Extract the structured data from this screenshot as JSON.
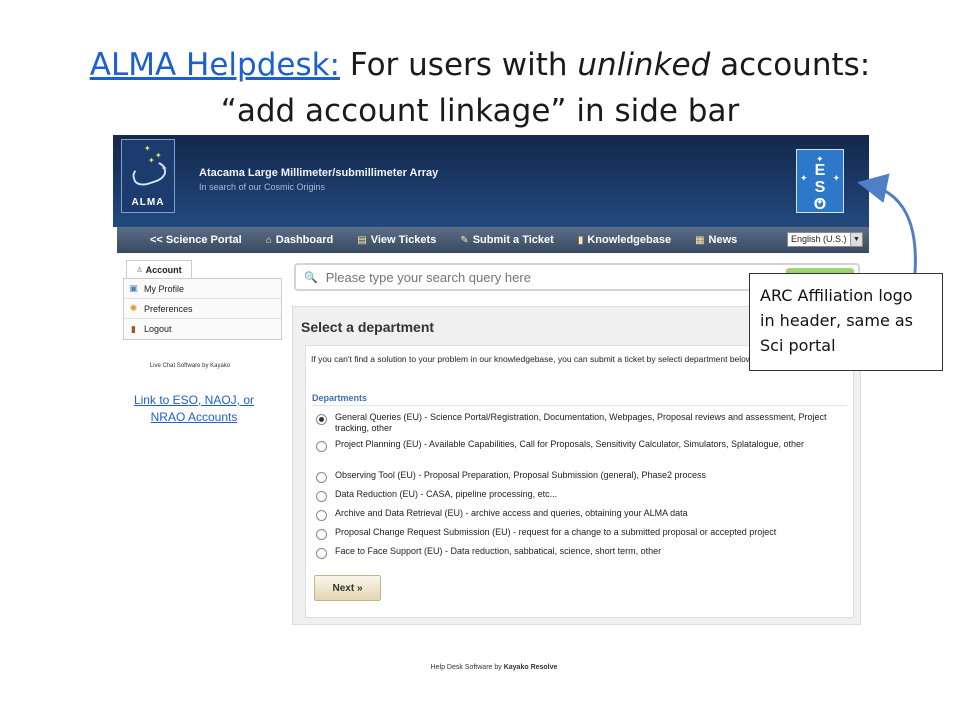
{
  "slide": {
    "title_link": "ALMA Helpdesk:",
    "title_pre": " For users with ",
    "title_em": "unlinked",
    "title_post": " accounts:",
    "title_line2": "“add account linkage” in side bar",
    "callout": "ARC Affiliation logo in header, same as Sci portal"
  },
  "header": {
    "alma_logo_word": "ALMA",
    "title": "Atacama Large Millimeter/submillimeter Array",
    "subtitle": "In search of our Cosmic Origins",
    "eso_letters": "ESO"
  },
  "nav": {
    "items": [
      {
        "label": "<< Science Portal",
        "icon": ""
      },
      {
        "label": "Dashboard",
        "icon": "home-icon"
      },
      {
        "label": "View Tickets",
        "icon": "tickets-icon"
      },
      {
        "label": "Submit a Ticket",
        "icon": "pencil-icon"
      },
      {
        "label": "Knowledgebase",
        "icon": "book-icon"
      },
      {
        "label": "News",
        "icon": "news-icon"
      }
    ],
    "language": "English (U.S.)"
  },
  "sidebar": {
    "tab": "Account",
    "items": [
      {
        "label": "My Profile",
        "icon": "profile-icon"
      },
      {
        "label": "Preferences",
        "icon": "gear-icon"
      },
      {
        "label": "Logout",
        "icon": "logout-icon"
      }
    ],
    "livechat": "Live Chat Software by Kayako",
    "link_accounts": "Link to ESO, NAOJ, or NRAO Accounts"
  },
  "search": {
    "placeholder": "Please type your search query here"
  },
  "department": {
    "title": "Select a department",
    "instructions": "If you can't find a solution to your problem in our knowledgebase, you can submit a ticket by selecti department below.",
    "label": "Departments",
    "options": [
      "General Queries (EU) - Science Portal/Registration, Documentation, Webpages, Proposal reviews and assessment, Project tracking, other",
      "Project Planning (EU) - Available Capabilities, Call for Proposals, Sensitivity Calculator, Simulators, Splatalogue, other",
      "Observing Tool (EU) - Proposal Preparation, Proposal Submission (general), Phase2 process",
      "Data Reduction (EU) - CASA, pipeline processing, etc...",
      "Archive and Data Retrieval (EU) - archive access and queries, obtaining your ALMA data",
      "Proposal Change Request Submission (EU) - request for a change to a submitted proposal or accepted project",
      "Face to Face Support (EU) - Data reduction, sabbatical, science, short term, other"
    ],
    "selected_index": 0,
    "next_label": "Next »"
  },
  "footer": {
    "prefix": "Help Desk Software",
    "middle": " by ",
    "brand": "Kayako Resolve"
  }
}
